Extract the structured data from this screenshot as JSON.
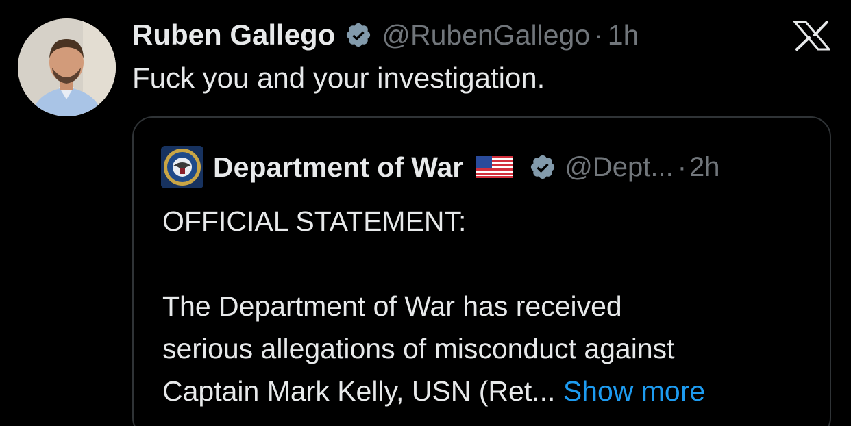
{
  "tweet": {
    "author_name": "Ruben Gallego",
    "author_handle": "@RubenGallego",
    "separator": "·",
    "time": "1h",
    "text": "Fuck you and your investigation."
  },
  "quoted_tweet": {
    "author_name": "Department of War",
    "flag_emoji": "us-flag",
    "author_handle": "@Dept...",
    "separator": "·",
    "time": "2h",
    "heading": "OFFICIAL STATEMENT:",
    "lines": [
      "The Department of War has received",
      "serious allegations of misconduct against",
      "Captain Mark Kelly, USN (Ret..."
    ],
    "show_more": "Show more"
  },
  "icons": {
    "verified": "verified-badge-icon",
    "platform": "x-logo-icon"
  },
  "colors": {
    "background": "#000000",
    "primary_text": "#e7e9ea",
    "secondary_text": "#71767b",
    "link": "#1d9bf0",
    "border": "#2f3336"
  }
}
